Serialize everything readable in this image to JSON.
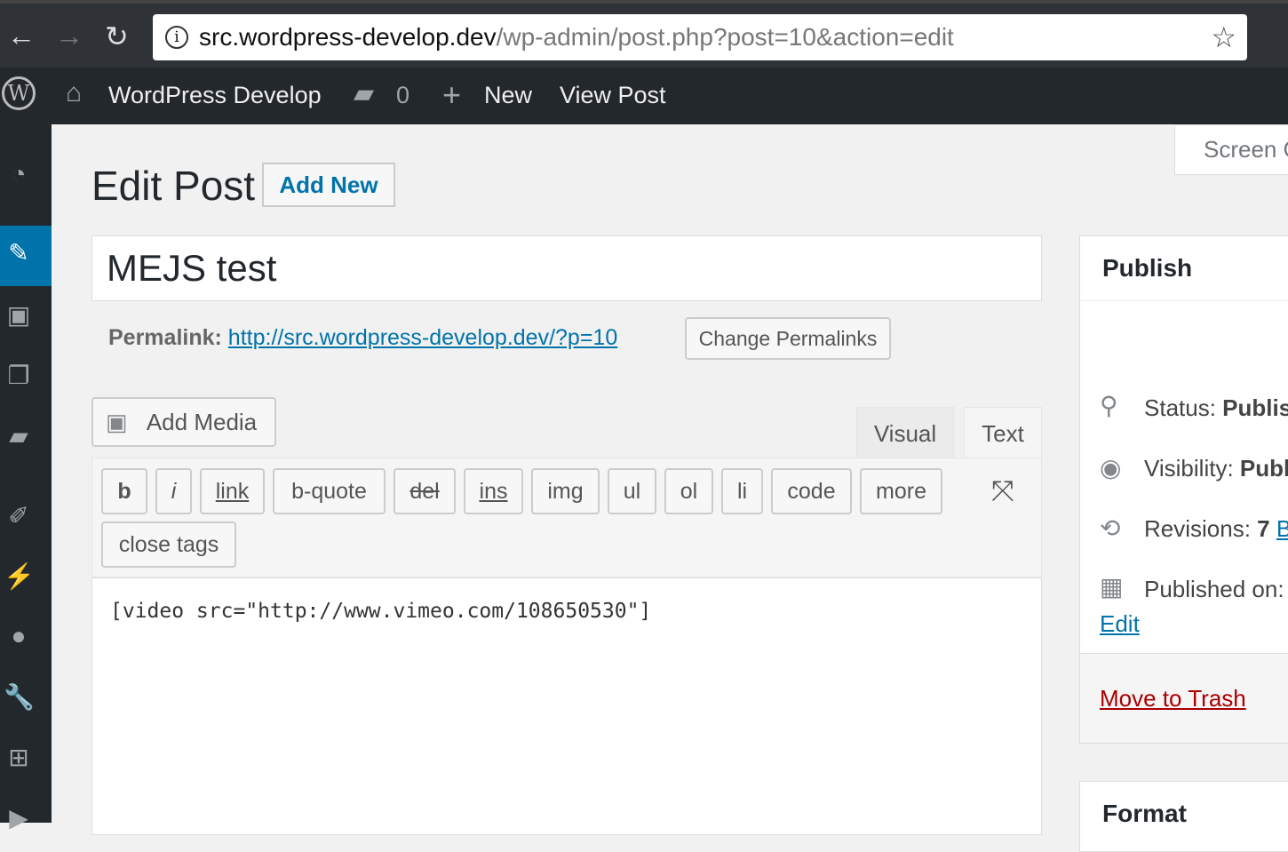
{
  "browser": {
    "url_host": "src.wordpress-develop.dev",
    "url_path": "/wp-admin/post.php?post=10&action=edit"
  },
  "adminbar": {
    "site": "WordPress Develop",
    "comments": "0",
    "new": "New",
    "view": "View Post"
  },
  "page": {
    "title": "Edit Post",
    "add_new": "Add New",
    "screen_options": "Screen Options"
  },
  "post": {
    "title": "MEJS test",
    "permalink_label": "Permalink:",
    "permalink": "http://src.wordpress-develop.dev/?p=10",
    "change_permalinks": "Change Permalinks"
  },
  "editor": {
    "add_media": "Add Media",
    "tab_visual": "Visual",
    "tab_text": "Text",
    "buttons": [
      "b",
      "i",
      "link",
      "b-quote",
      "del",
      "ins",
      "img",
      "ul",
      "ol",
      "li",
      "code",
      "more"
    ],
    "close_tags": "close tags",
    "content": "[video src=\"http://www.vimeo.com/108650530\"]"
  },
  "publish": {
    "title": "Publish",
    "status_label": "Status:",
    "status": "Published",
    "visibility_label": "Visibility:",
    "visibility": "Public",
    "revisions_label": "Revisions:",
    "revisions": "7",
    "browse": "Browse",
    "published_on": "Published on:",
    "edit": "Edit",
    "trash": "Move to Trash"
  },
  "format": {
    "title": "Format"
  },
  "colors": {
    "accent": "#0073aa",
    "admin_bar": "#23282d",
    "trash": "#a00"
  }
}
